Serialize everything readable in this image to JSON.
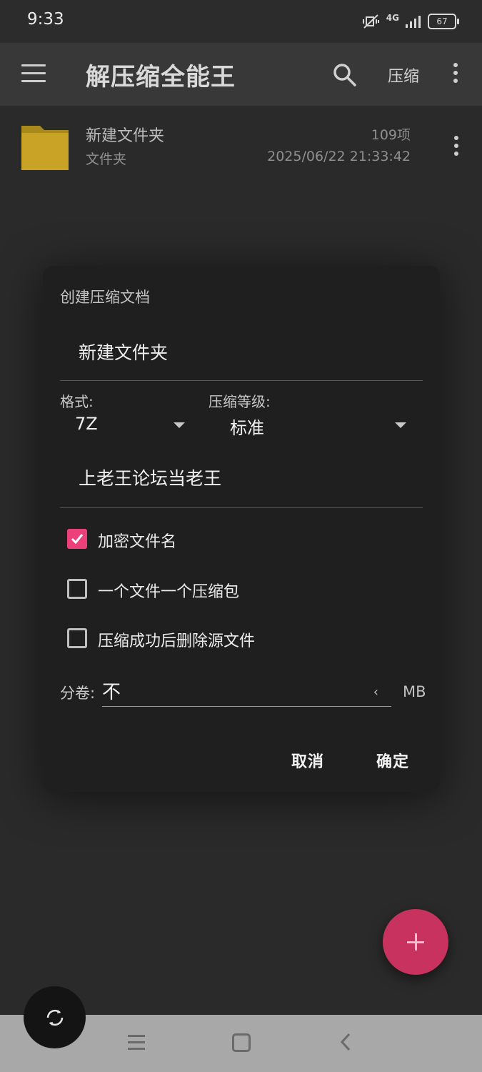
{
  "status_bar": {
    "time": "9:33",
    "network": "4G",
    "battery": "67"
  },
  "app_bar": {
    "title": "解压缩全能王",
    "compress_label": "压缩",
    "icons": [
      "menu-icon",
      "search-icon",
      "more-vert-icon"
    ]
  },
  "file": {
    "name": "新建文件夹",
    "type": "文件夹",
    "count": "109项",
    "date": "2025/06/22 21:33:42"
  },
  "dialog": {
    "title": "创建压缩文档",
    "filename": "新建文件夹",
    "format_label": "格式:",
    "format_value": "7Z",
    "level_label": "压缩等级:",
    "level_value": "标准",
    "password": "上老王论坛当老王",
    "options": [
      {
        "label": "加密文件名",
        "checked": true
      },
      {
        "label": "一个文件一个压缩包",
        "checked": false
      },
      {
        "label": "压缩成功后删除源文件",
        "checked": false
      }
    ],
    "volume_label": "分卷:",
    "volume_value": "不",
    "volume_unit": "MB",
    "cancel": "取消",
    "confirm": "确定"
  },
  "colors": {
    "accent": "#ec407a",
    "fab": "#c8325f",
    "background": "#2a2a2a",
    "dialog": "#1f1f1f"
  }
}
